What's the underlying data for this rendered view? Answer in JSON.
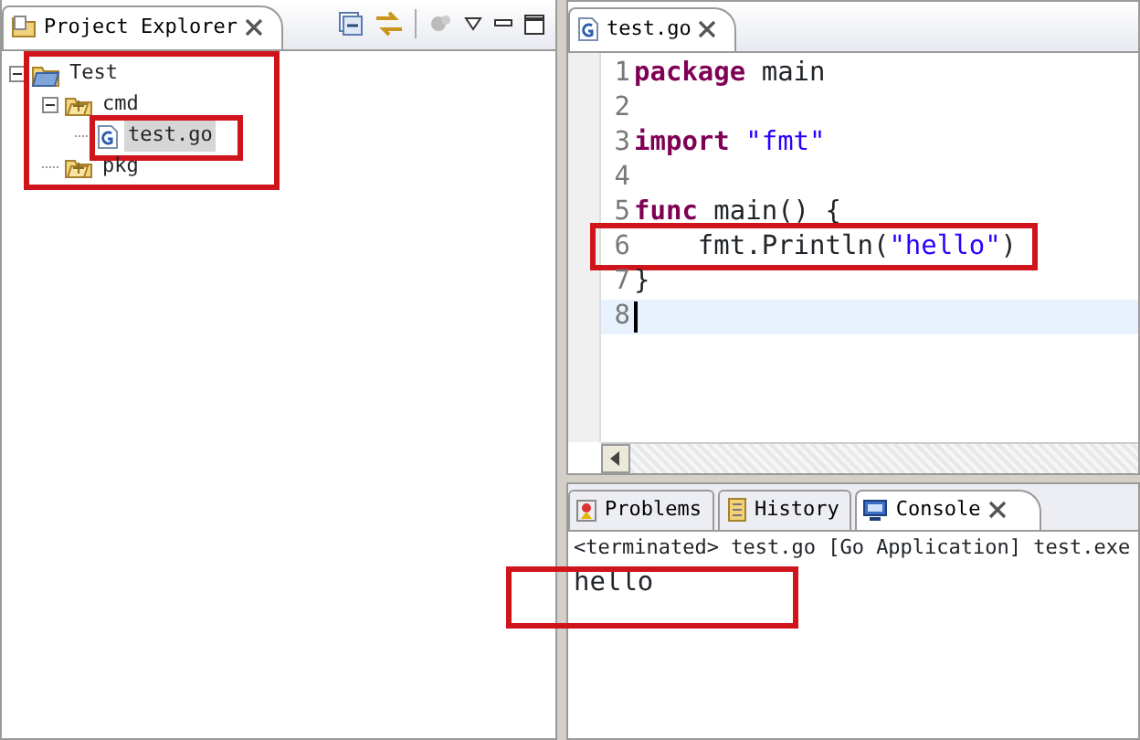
{
  "project_explorer": {
    "title": "Project Explorer",
    "tree": [
      {
        "label": "Test",
        "kind": "project",
        "expanded": true,
        "selected": false,
        "highlighted": true,
        "children": [
          {
            "label": "cmd",
            "kind": "package",
            "expanded": true,
            "selected": false,
            "highlighted": false,
            "children": [
              {
                "label": "test.go",
                "kind": "file",
                "selected": true,
                "highlighted": true
              }
            ]
          },
          {
            "label": "pkg",
            "kind": "package",
            "selected": false,
            "highlighted": false
          }
        ]
      }
    ]
  },
  "editor": {
    "tab": "test.go",
    "lines": [
      {
        "number": "1",
        "highlighted": false,
        "current": false,
        "tokens": [
          {
            "kind": "keyword",
            "text": "package"
          },
          {
            "kind": "plain",
            "text": " main"
          }
        ]
      },
      {
        "number": "2",
        "highlighted": false,
        "current": false
      },
      {
        "number": "3",
        "highlighted": false,
        "current": false,
        "tokens": [
          {
            "kind": "keyword",
            "text": "import"
          },
          {
            "kind": "string",
            "text": " \"fmt\""
          }
        ]
      },
      {
        "number": "4",
        "highlighted": false,
        "current": false
      },
      {
        "number": "5",
        "highlighted": false,
        "current": false,
        "tokens": [
          {
            "kind": "keyword",
            "text": "func"
          },
          {
            "kind": "plain",
            "text": " main() {"
          }
        ]
      },
      {
        "number": "6",
        "highlighted": true,
        "current": false,
        "tokens": [
          {
            "kind": "plain",
            "text": "    fmt.Println("
          },
          {
            "kind": "string",
            "text": "\"hello\""
          },
          {
            "kind": "plain",
            "text": ")"
          }
        ]
      },
      {
        "number": "7",
        "highlighted": false,
        "current": false,
        "tokens": [
          {
            "kind": "plain",
            "text": "}"
          }
        ]
      },
      {
        "number": "8",
        "highlighted": false,
        "current": true
      }
    ]
  },
  "bottom_panel": {
    "tabs": [
      {
        "label": "Problems",
        "kind": "problems",
        "selected": false
      },
      {
        "label": "History",
        "kind": "history",
        "selected": false
      },
      {
        "label": "Console",
        "kind": "console",
        "selected": true
      }
    ],
    "console": {
      "status": "<terminated> test.go [Go Application] test.exe",
      "output": "hello",
      "highlighted": true
    }
  }
}
